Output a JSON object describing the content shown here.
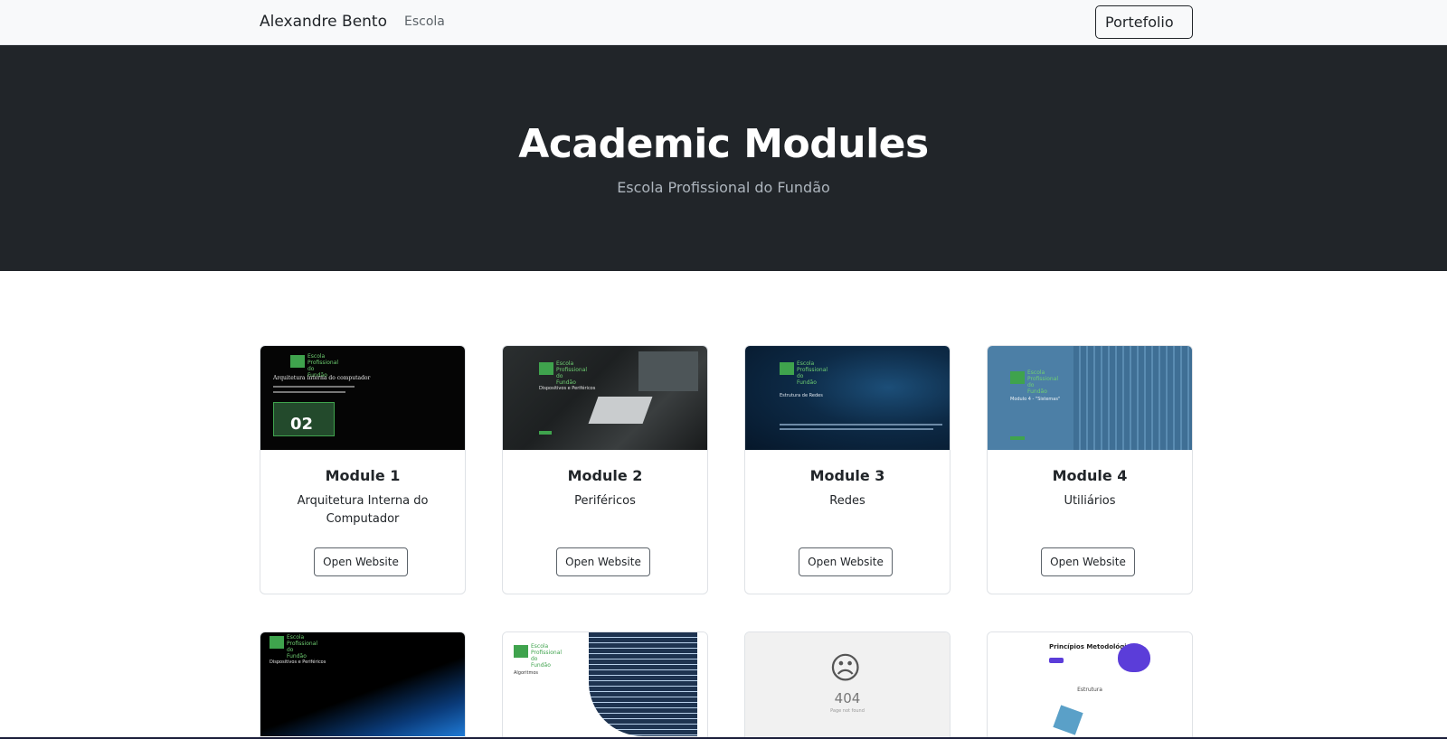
{
  "navbar": {
    "brand": "Alexandre Bento",
    "link": "Escola",
    "button": "Portefolio"
  },
  "hero": {
    "title": "Academic Modules",
    "subtitle": "Escola Profissional do Fundão"
  },
  "cards": [
    {
      "title": "Module 1",
      "text": "Arquitetura Interna do Computador",
      "button": "Open Website"
    },
    {
      "title": "Module 2",
      "text": "Periféricos",
      "button": "Open Website"
    },
    {
      "title": "Module 3",
      "text": "Redes",
      "button": "Open Website"
    },
    {
      "title": "Module 4",
      "text": "Utiliários",
      "button": "Open Website"
    }
  ],
  "thumbnails": {
    "school_logo_text": "Escola Profissional do Fundão",
    "m1_heading": "Arquitetura interna do computador",
    "m1_badge": "02",
    "m2_heading": "Dispositivos e Periféricos",
    "m3_heading": "Estrutura de Redes",
    "m4_heading": "Modulo 4 - \"Sistemas\"",
    "m5_heading": "Dispositivos e Periféricos",
    "m6_heading": "Algoritmos",
    "m7_code": "404",
    "m7_text": "Page not found",
    "m8_heading": "Princípios Metodológicos",
    "m8_section": "Estrutura"
  },
  "colors": {
    "navbar_bg": "#f8f9fa",
    "hero_bg": "#212529",
    "accent_green": "#3fa34d"
  }
}
